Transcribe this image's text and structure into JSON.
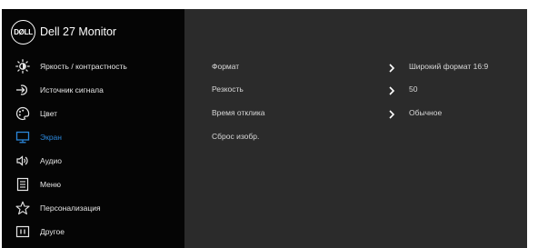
{
  "header": {
    "logo_text": "DØLL",
    "model": "Dell 27 Monitor"
  },
  "sidebar": {
    "items": [
      {
        "label": "Яркость / контрастность",
        "icon": "brightness-icon"
      },
      {
        "label": "Источник сигнала",
        "icon": "input-source-icon"
      },
      {
        "label": "Цвет",
        "icon": "color-palette-icon"
      },
      {
        "label": "Экран",
        "icon": "display-icon",
        "active": true
      },
      {
        "label": "Аудио",
        "icon": "speaker-icon"
      },
      {
        "label": "Меню",
        "icon": "menu-list-icon"
      },
      {
        "label": "Персонализация",
        "icon": "star-icon"
      },
      {
        "label": "Другое",
        "icon": "info-box-icon"
      }
    ]
  },
  "content": {
    "rows": [
      {
        "label": "Формат",
        "value": "Широкий формат 16:9"
      },
      {
        "label": "Резкость",
        "value": "50"
      },
      {
        "label": "Время отклика",
        "value": "Обычное"
      },
      {
        "label": "Сброс изобр.",
        "value": ""
      }
    ]
  },
  "colors": {
    "sidebar_bg": "#050505",
    "content_bg": "#2b2b2b",
    "active_accent": "#2b86d9",
    "text": "#e6e6e6"
  }
}
